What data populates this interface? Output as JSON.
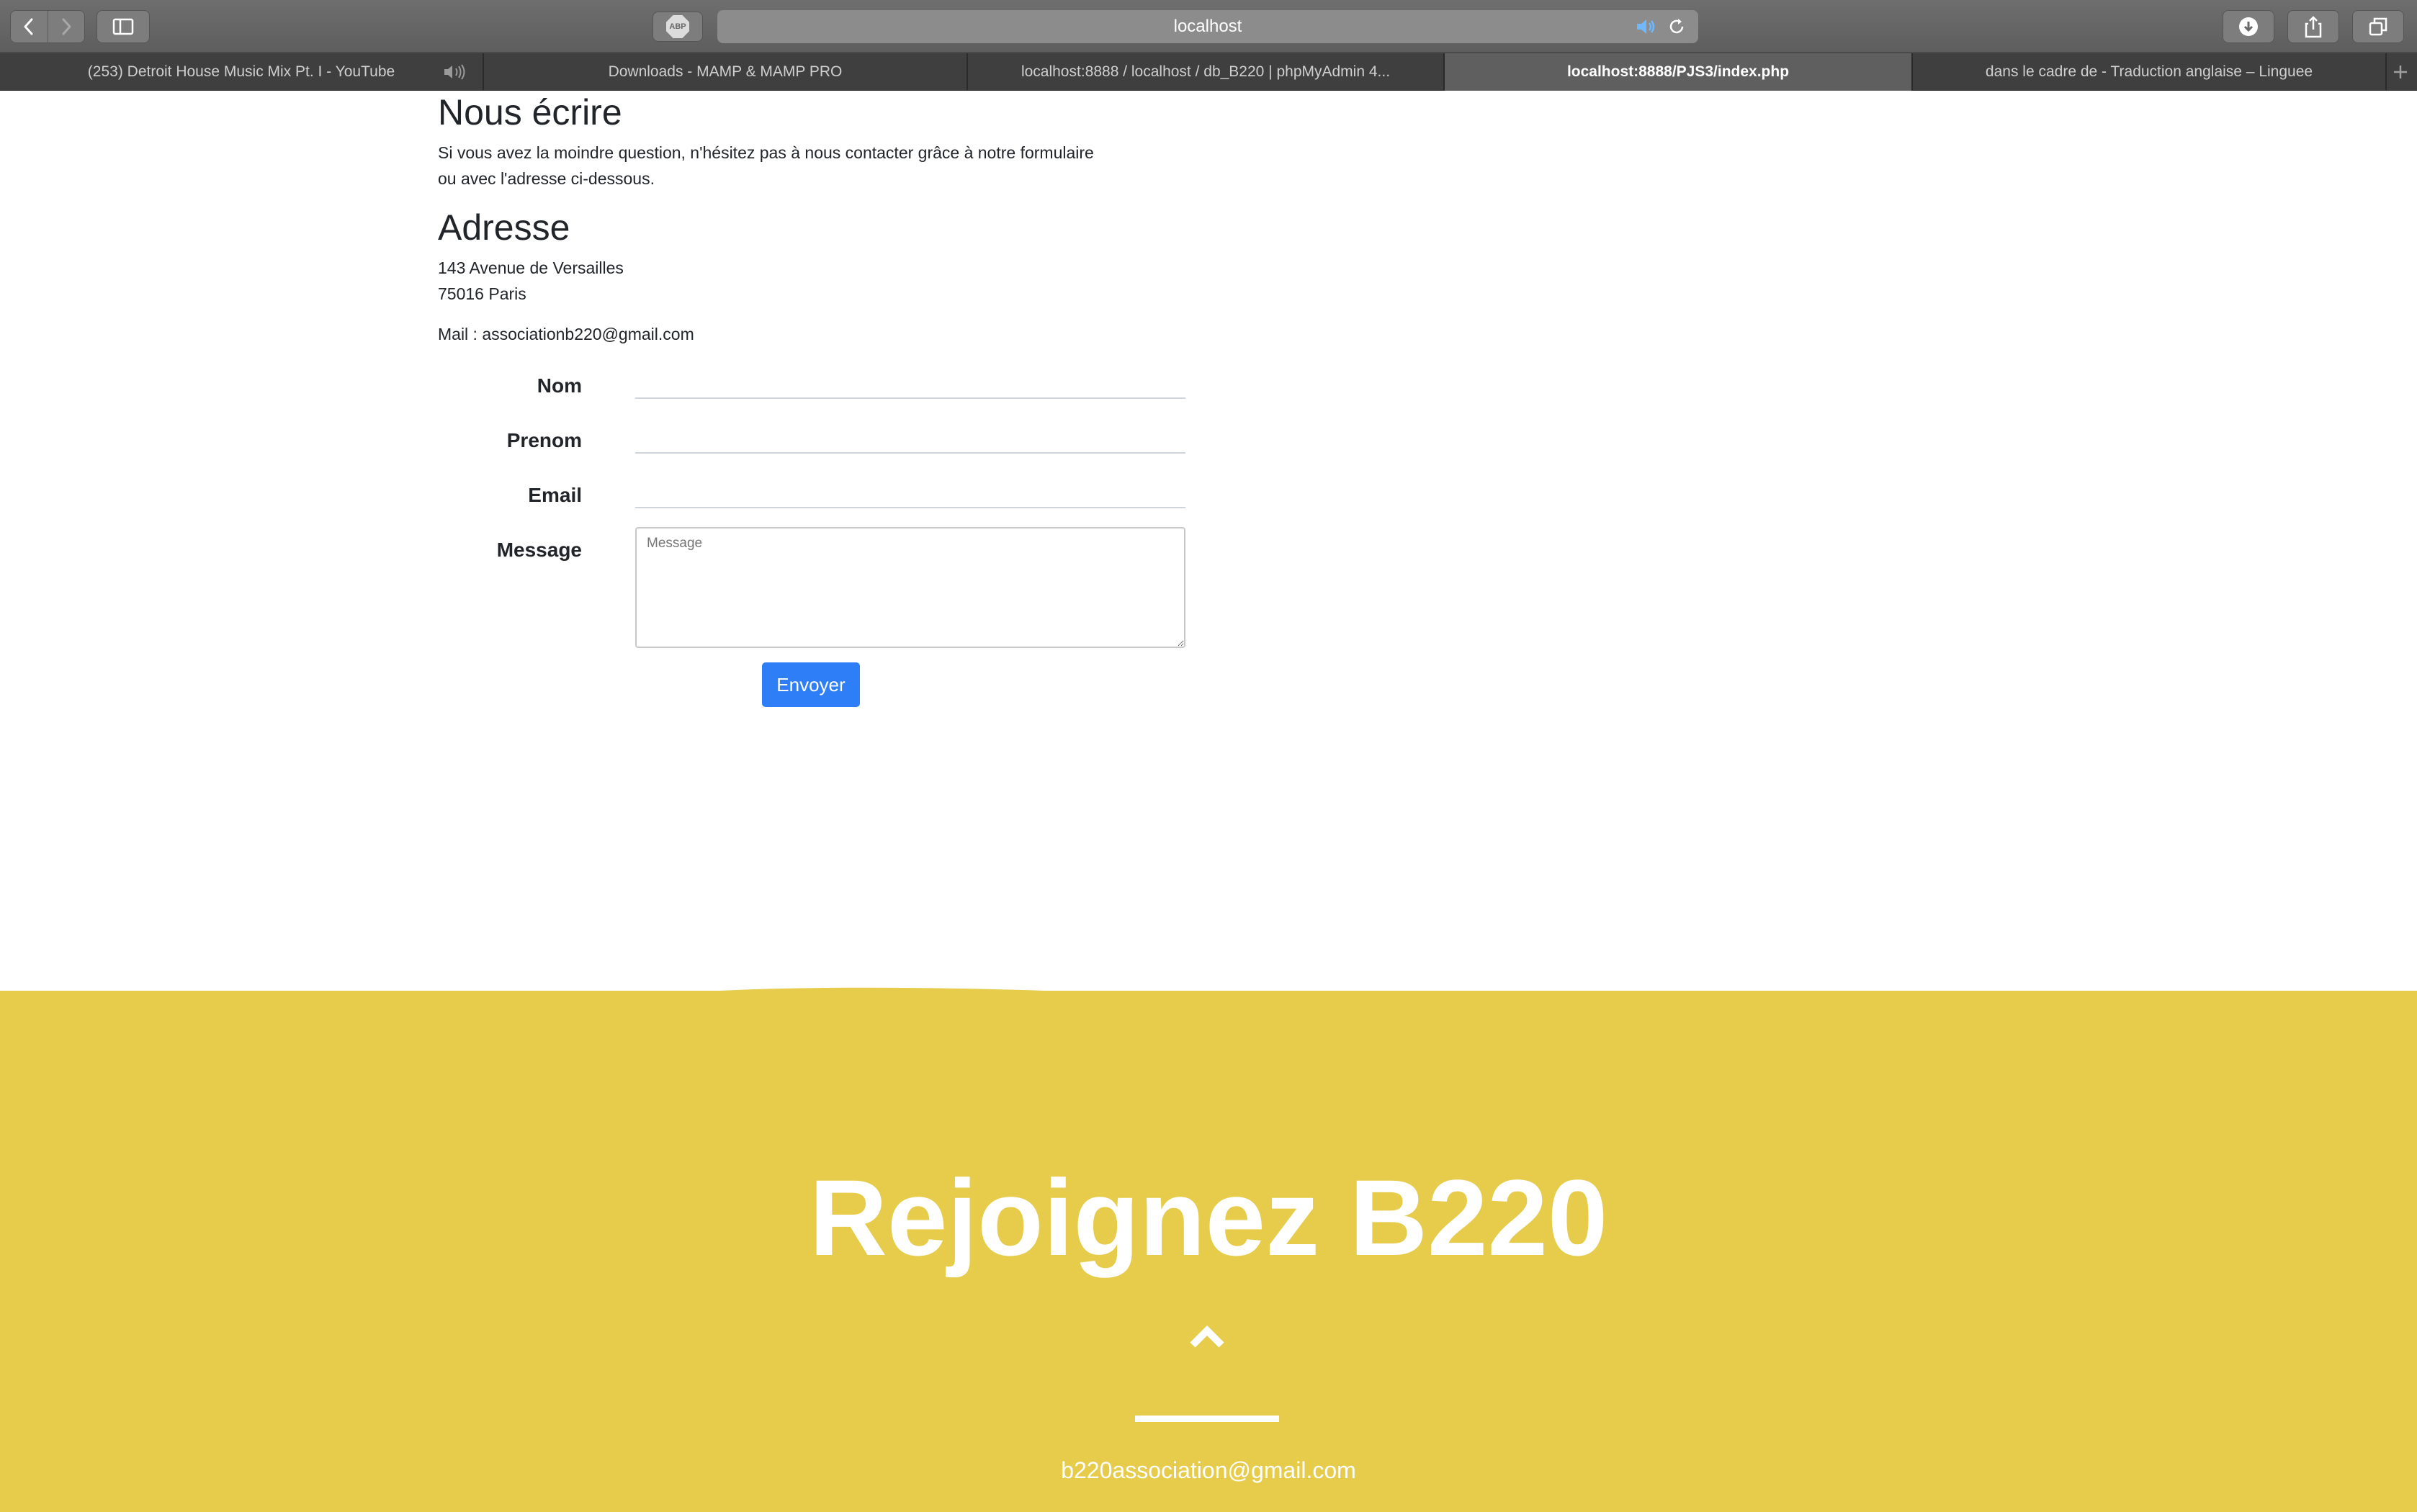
{
  "browser": {
    "address": "localhost",
    "abp_label": "ABP",
    "tabs": [
      {
        "title": "(253) Detroit House Music Mix Pt. I - YouTube",
        "active": false
      },
      {
        "title": "Downloads - MAMP & MAMP PRO",
        "active": false
      },
      {
        "title": "localhost:8888 / localhost / db_B220 | phpMyAdmin 4...",
        "active": false
      },
      {
        "title": "localhost:8888/PJS3/index.php",
        "active": true
      },
      {
        "title": "dans le cadre de - Traduction anglaise – Linguee",
        "active": false
      }
    ]
  },
  "contact": {
    "heading": "Nous écrire",
    "intro_line1": "Si vous avez la moindre question, n'hésitez pas à nous contacter grâce à notre formulaire",
    "intro_line2": "ou avec l'adresse ci-dessous.",
    "address_heading": "Adresse",
    "street": "143 Avenue de Versailles",
    "city": "75016 Paris",
    "mail": "Mail : associationb220@gmail.com"
  },
  "form": {
    "nom_label": "Nom",
    "prenom_label": "Prenom",
    "email_label": "Email",
    "message_label": "Message",
    "message_placeholder": "Message",
    "submit_label": "Envoyer"
  },
  "footer": {
    "title": "Rejoignez B220",
    "email": "b220association@gmail.com",
    "background_color": "#e6cc4a"
  },
  "icons": [
    "chevron-left-icon",
    "chevron-right-icon",
    "sidebar-icon",
    "adblock-icon",
    "speaker-icon",
    "reload-icon",
    "download-icon",
    "share-icon",
    "tabs-overview-icon",
    "plus-icon",
    "chevron-up-icon"
  ]
}
